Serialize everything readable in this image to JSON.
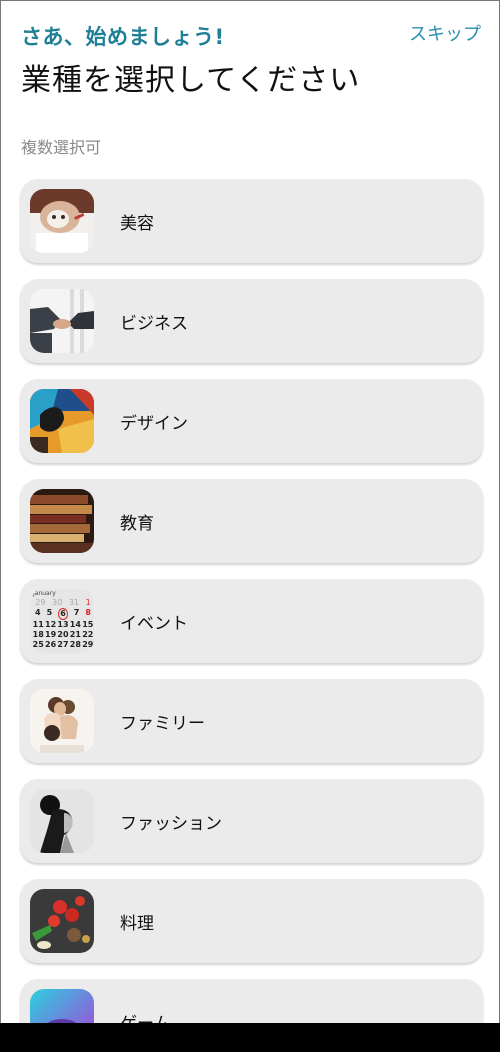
{
  "header": {
    "greeting": "さあ、始めましょう!",
    "skip_label": "スキップ",
    "title": "業種を選択してください",
    "hint": "複数選択可"
  },
  "categories": [
    {
      "label": "美容",
      "icon": "beauty-photo"
    },
    {
      "label": "ビジネス",
      "icon": "handshake-photo"
    },
    {
      "label": "デザイン",
      "icon": "abstract-art-photo"
    },
    {
      "label": "教育",
      "icon": "books-photo"
    },
    {
      "label": "イベント",
      "icon": "calendar-photo"
    },
    {
      "label": "ファミリー",
      "icon": "couple-photo"
    },
    {
      "label": "ファッション",
      "icon": "fashion-portrait-photo"
    },
    {
      "label": "料理",
      "icon": "food-photo"
    },
    {
      "label": "ゲーム",
      "icon": "gaming-photo"
    }
  ],
  "calendar_thumb": {
    "month": "January",
    "rows": [
      [
        "29",
        "30",
        "31",
        "1"
      ],
      [
        "4",
        "5",
        "6",
        "7",
        "8"
      ],
      [
        "11",
        "12",
        "13",
        "14",
        "15"
      ],
      [
        "18",
        "19",
        "20",
        "21",
        "22"
      ],
      [
        "25",
        "26",
        "27",
        "28",
        "29"
      ]
    ]
  },
  "colors": {
    "accent": "#1f7f96",
    "link": "#2a8fb0",
    "card_bg": "#ebebeb"
  }
}
